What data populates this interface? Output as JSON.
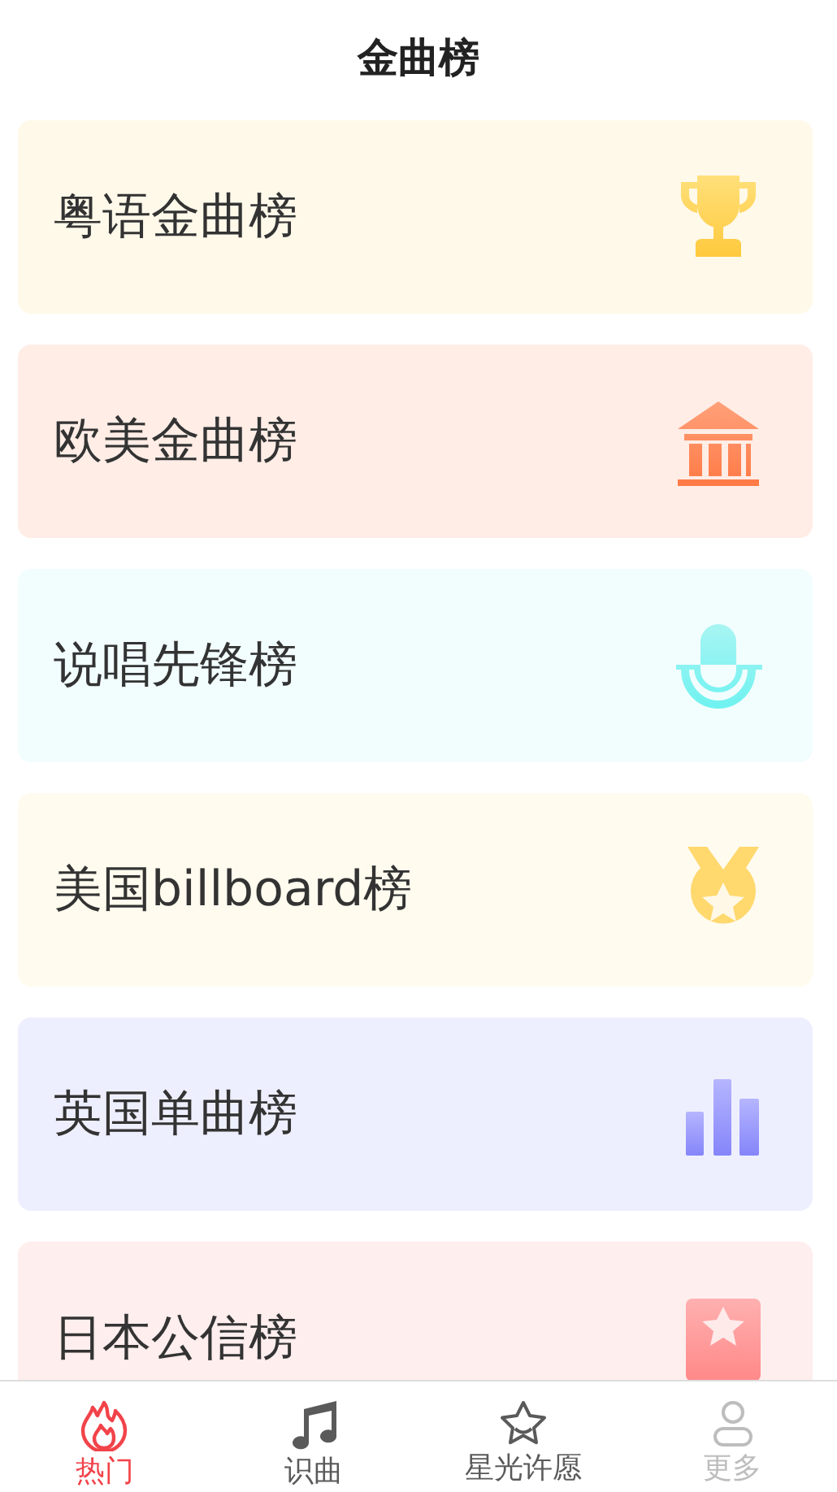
{
  "header": {
    "title": "金曲榜"
  },
  "charts": [
    {
      "title": "粤语金曲榜",
      "kind": "trophy",
      "color": "#fff9ea"
    },
    {
      "title": "欧美金曲榜",
      "kind": "building",
      "color": "#ffede6"
    },
    {
      "title": "说唱先锋榜",
      "kind": "microphone",
      "color": "#f2fdfe"
    },
    {
      "title": "美国billboard榜",
      "kind": "medal",
      "color": "#fffbee"
    },
    {
      "title": "英国单曲榜",
      "kind": "bars",
      "color": "#eeeffe"
    },
    {
      "title": "日本公信榜",
      "kind": "star-card",
      "color": "#ffeeee"
    }
  ],
  "tab_bar": [
    {
      "label": "热门",
      "kind": "flame",
      "selected": true,
      "disabled": false
    },
    {
      "label": "识曲",
      "kind": "note",
      "selected": false,
      "disabled": false
    },
    {
      "label": "星光许愿",
      "kind": "star",
      "selected": false,
      "disabled": false
    },
    {
      "label": "更多",
      "kind": "person",
      "selected": false,
      "disabled": true
    }
  ]
}
